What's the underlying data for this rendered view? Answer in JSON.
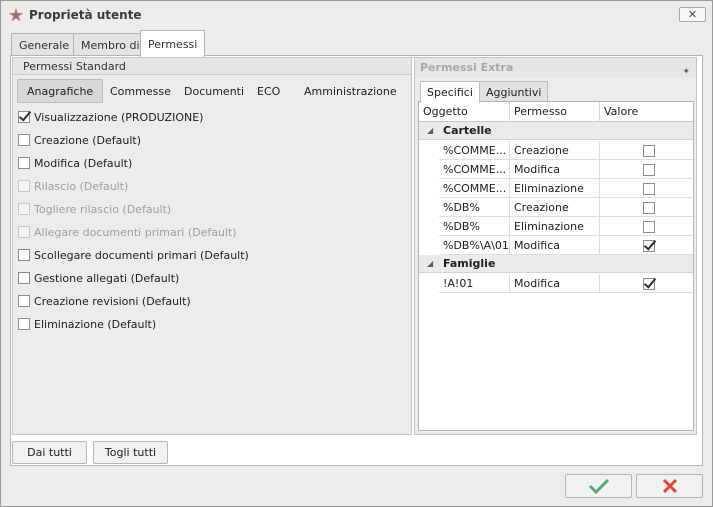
{
  "window": {
    "title": "Proprietà utente",
    "close_label": "✕"
  },
  "main_tabs": [
    {
      "label": "Generale"
    },
    {
      "label": "Membro di"
    },
    {
      "label": "Permessi"
    }
  ],
  "standard": {
    "header": "Permessi Standard",
    "subtabs": [
      "Anagrafiche",
      "Commesse",
      "Documenti",
      "ECO",
      "Amministrazione"
    ],
    "active_subtab": "Anagrafiche",
    "permissions": [
      {
        "label": "Visualizzazione (PRODUZIONE)",
        "checked": true,
        "enabled": true
      },
      {
        "label": "Creazione (Default)",
        "checked": false,
        "enabled": true
      },
      {
        "label": "Modifica (Default)",
        "checked": false,
        "enabled": true
      },
      {
        "label": "Rilascio (Default)",
        "checked": false,
        "enabled": false
      },
      {
        "label": "Togliere rilascio (Default)",
        "checked": false,
        "enabled": false
      },
      {
        "label": "Allegare documenti primari (Default)",
        "checked": false,
        "enabled": false
      },
      {
        "label": "Scollegare documenti primari (Default)",
        "checked": false,
        "enabled": true
      },
      {
        "label": "Gestione allegati (Default)",
        "checked": false,
        "enabled": true
      },
      {
        "label": "Creazione revisioni (Default)",
        "checked": false,
        "enabled": true
      },
      {
        "label": "Eliminazione (Default)",
        "checked": false,
        "enabled": true
      }
    ]
  },
  "buttons": {
    "give_all": "Dai tutti",
    "remove_all": "Togli tutti"
  },
  "extra": {
    "header": "Permessi Extra",
    "tabs": [
      "Specifici",
      "Aggiuntivi"
    ],
    "columns": [
      "Oggetto",
      "Permesso",
      "Valore"
    ],
    "groups": [
      {
        "name": "Cartelle",
        "rows": [
          {
            "object": "%COMME...",
            "permission": "Creazione",
            "value": false
          },
          {
            "object": "%COMME...",
            "permission": "Modifica",
            "value": false
          },
          {
            "object": "%COMME...",
            "permission": "Eliminazione",
            "value": false
          },
          {
            "object": "%DB%",
            "permission": "Creazione",
            "value": false
          },
          {
            "object": "%DB%",
            "permission": "Eliminazione",
            "value": false
          },
          {
            "object": "%DB%\\A\\01",
            "permission": "Modifica",
            "value": true
          }
        ]
      },
      {
        "name": "Famiglie",
        "rows": [
          {
            "object": "!A!01",
            "permission": "Modifica",
            "value": true
          }
        ]
      }
    ]
  },
  "colors": {
    "ok": "#4fae7c",
    "cancel": "#e0473a"
  }
}
